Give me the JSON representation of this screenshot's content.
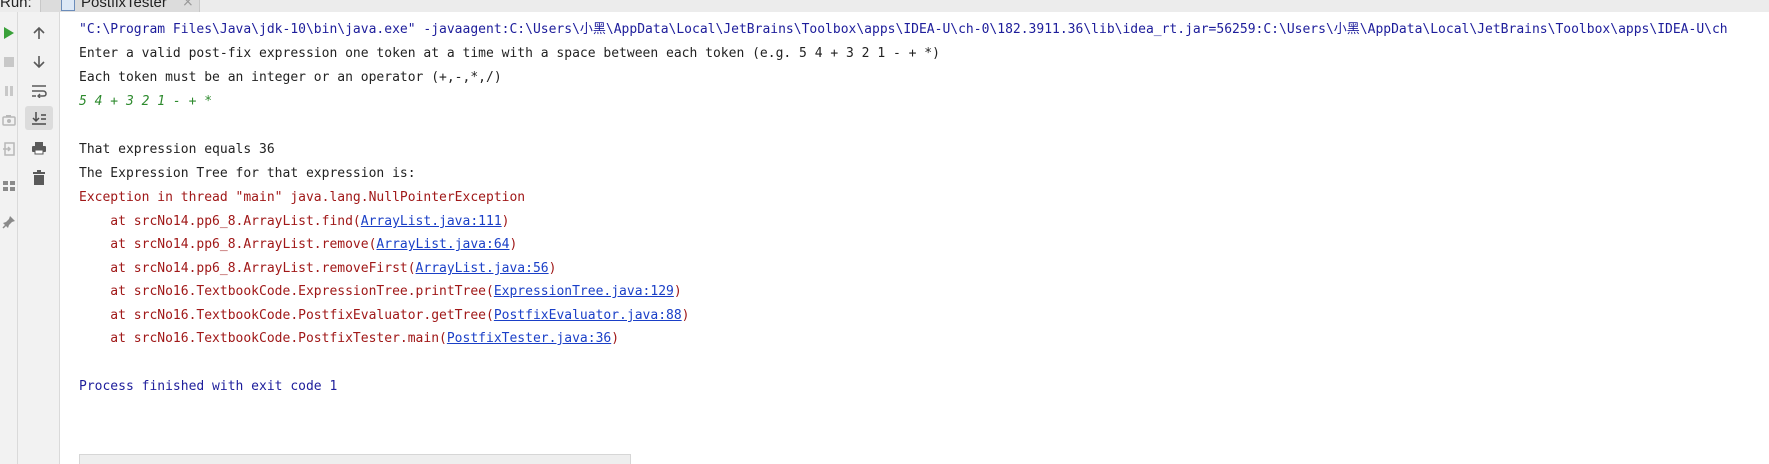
{
  "header": {
    "run_label": "Run:",
    "tab_title": "PostfixTester",
    "tab_close": "×"
  },
  "toolbar": {
    "buttons": [
      "rerun",
      "stop",
      "pause",
      "snapshot",
      "exit",
      "layout",
      "pin",
      "up",
      "down",
      "soft-wrap",
      "scroll-to-end",
      "print",
      "clear"
    ]
  },
  "console": {
    "lines": [
      {
        "text": "\"C:\\Program Files\\Java\\jdk-10\\bin\\java.exe\" -javaagent:C:\\Users\\小黑\\AppData\\Local\\JetBrains\\Toolbox\\apps\\IDEA-U\\ch-0\\182.3911.36\\lib\\idea_rt.jar=56259:C:\\Users\\小黑\\AppData\\Local\\JetBrains\\Toolbox\\apps\\IDEA-U\\ch"
      },
      {
        "text": "Enter a valid post-fix expression one token at a time with a space between each token (e.g. 5 4 + 3 2 1 - + *)"
      },
      {
        "text": "Each token must be an integer or an operator (+,-,*,/)"
      },
      {
        "text": "5 4 + 3 2 1 - + *"
      },
      {
        "text": ""
      },
      {
        "text": "That expression equals 36"
      },
      {
        "text": "The Expression Tree for that expression is:"
      },
      {
        "text": "Exception in thread \"main\" java.lang.NullPointerException"
      }
    ],
    "stack": [
      {
        "prefix": "    at srcNo14.pp6_8.ArrayList.find(",
        "link": "ArrayList.java:111",
        "suffix": ")"
      },
      {
        "prefix": "    at srcNo14.pp6_8.ArrayList.remove(",
        "link": "ArrayList.java:64",
        "suffix": ")"
      },
      {
        "prefix": "    at srcNo14.pp6_8.ArrayList.removeFirst(",
        "link": "ArrayList.java:56",
        "suffix": ")"
      },
      {
        "prefix": "    at srcNo16.TextbookCode.ExpressionTree.printTree(",
        "link": "ExpressionTree.java:129",
        "suffix": ")"
      },
      {
        "prefix": "    at srcNo16.TextbookCode.PostfixEvaluator.getTree(",
        "link": "PostfixEvaluator.java:88",
        "suffix": ")"
      },
      {
        "prefix": "    at srcNo16.TextbookCode.PostfixTester.main(",
        "link": "PostfixTester.java:36",
        "suffix": ")"
      }
    ],
    "finish": "Process finished with exit code 1"
  },
  "colors": {
    "command": "#1d1d9b",
    "input": "#2d8a2d",
    "error": "#a01818",
    "link": "#1a3fc7"
  }
}
